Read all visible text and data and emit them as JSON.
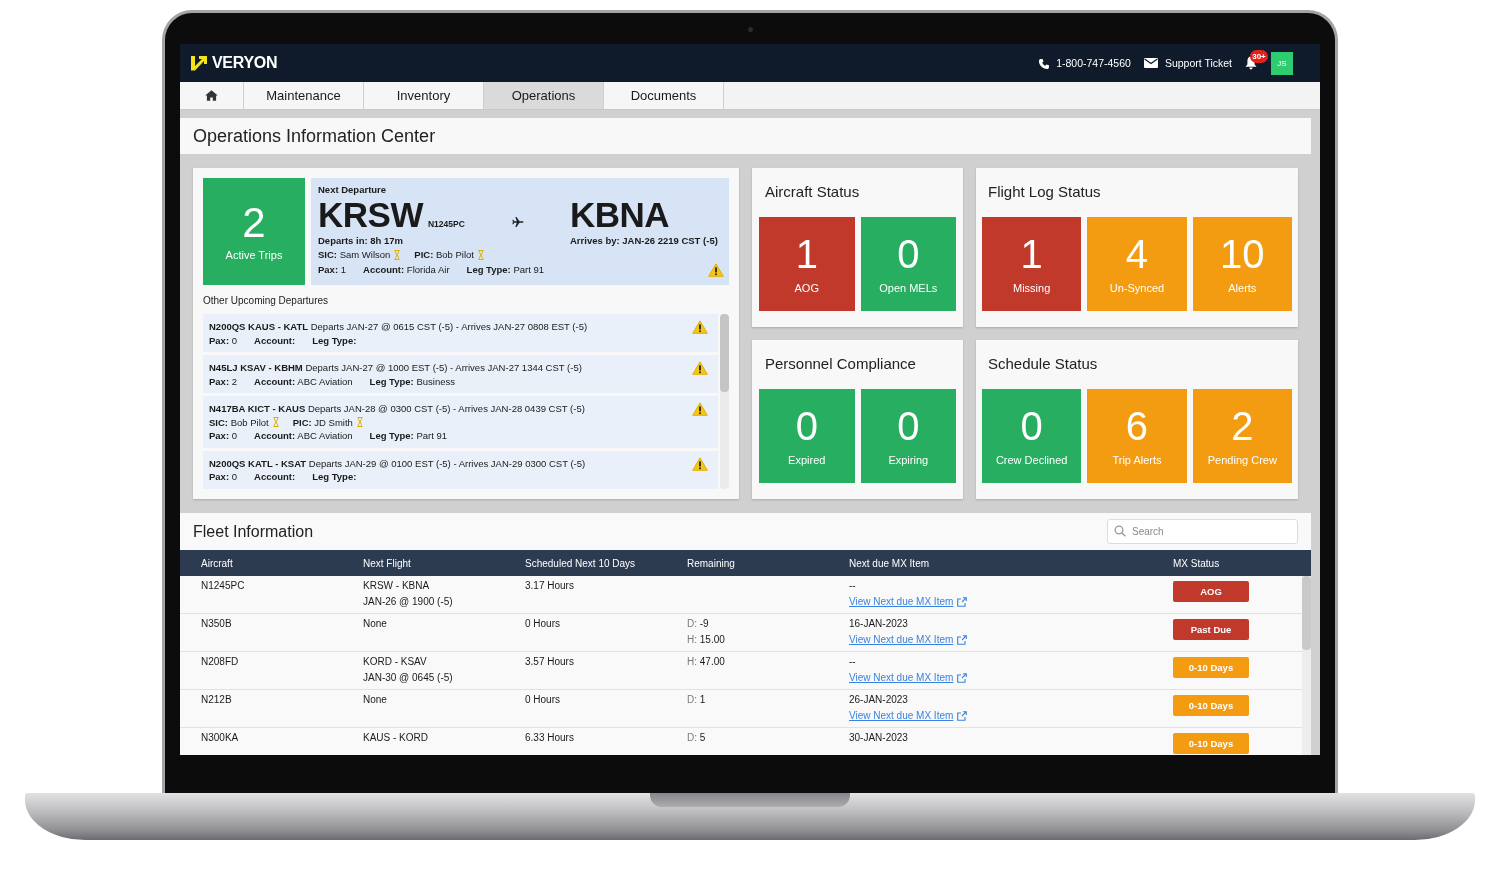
{
  "header": {
    "logo": "VERYON",
    "phone": "1-800-747-4560",
    "support": "Support Ticket",
    "notification_count": "30+",
    "user_initials": "JS"
  },
  "nav": {
    "tabs": [
      {
        "kind": "home",
        "selected": false
      },
      {
        "kind": "text",
        "label": "Maintenance",
        "selected": false
      },
      {
        "kind": "text",
        "label": "Inventory",
        "selected": false
      },
      {
        "kind": "text",
        "label": "Operations",
        "selected": true
      },
      {
        "kind": "text",
        "label": "Documents",
        "selected": false
      }
    ]
  },
  "page_title": "Operations Information Center",
  "trips": {
    "active_trips": {
      "count": "2",
      "label": "Active Trips"
    },
    "next_departure": {
      "heading": "Next Departure",
      "origin": "KRSW",
      "tail_number": "N1245PC",
      "destination": "KBNA",
      "departs": "Departs in: 8h 17m",
      "arrives": "Arrives by: JAN-26 2219 CST (-5)",
      "crew": [
        {
          "label": "SIC:",
          "value": "Sam Wilson"
        },
        {
          "label": "PIC:",
          "value": "Bob Pilot"
        }
      ],
      "details": [
        {
          "label": "Pax:",
          "value": "1"
        },
        {
          "label": "Account:",
          "value": "Florida Air"
        },
        {
          "label": "Leg Type:",
          "value": "Part 91"
        }
      ]
    },
    "upcoming_heading": "Other Upcoming Departures",
    "upcoming": [
      {
        "summary": "**N200QS KAUS - KATL** Departs JAN-27 @ 0615 CST (-5) - Arrives JAN-27 0808 EST (-5)",
        "details": [
          {
            "label": "Pax:",
            "value": "0"
          },
          {
            "label": "Account:"
          },
          {
            "label": "Leg Type:"
          }
        ]
      },
      {
        "summary": "**N45LJ KSAV - KBHM** Departs JAN-27 @ 1000 EST (-5) - Arrives JAN-27 1344 CST (-5)",
        "details": [
          {
            "label": "Pax:",
            "value": "2"
          },
          {
            "label": "Account:",
            "value": "ABC Aviation"
          },
          {
            "label": "Leg Type:",
            "value": "Business"
          }
        ]
      },
      {
        "summary": "**N417BA KICT - KAUS** Departs JAN-28 @ 0300 CST (-5) - Arrives JAN-28 0439 CST (-5)",
        "crew": [
          {
            "label": "SIC:",
            "value": "Bob Pilot"
          },
          {
            "label": "PIC:",
            "value": "JD Smith"
          }
        ],
        "details": [
          {
            "label": "Pax:",
            "value": "0"
          },
          {
            "label": "Account:",
            "value": "ABC Aviation"
          },
          {
            "label": "Leg Type:",
            "value": "Part 91"
          }
        ]
      },
      {
        "summary": "**N200QS KATL - KSAT** Departs JAN-29 @ 0100 EST (-5) - Arrives JAN-29 0300 CST (-5)",
        "details": [
          {
            "label": "Pax:",
            "value": "0"
          },
          {
            "label": "Account:"
          },
          {
            "label": "Leg Type:"
          }
        ]
      }
    ]
  },
  "status_cards": [
    {
      "title": "Aircraft Status",
      "tiles": [
        {
          "value": "1",
          "label": "AOG",
          "color": "#c0392b"
        },
        {
          "value": "0",
          "label": "Open MELs",
          "color": "#27ae60"
        }
      ]
    },
    {
      "title": "Flight Log Status",
      "tiles": [
        {
          "value": "1",
          "label": "Missing",
          "color": "#c0392b"
        },
        {
          "value": "4",
          "label": "Un-Synced",
          "color": "#f39c12"
        },
        {
          "value": "10",
          "label": "Alerts",
          "color": "#f39c12"
        }
      ]
    },
    {
      "title": "Personnel Compliance",
      "tiles": [
        {
          "value": "0",
          "label": "Expired",
          "color": "#27ae60"
        },
        {
          "value": "0",
          "label": "Expiring",
          "color": "#27ae60"
        }
      ]
    },
    {
      "title": "Schedule Status",
      "tiles": [
        {
          "value": "0",
          "label": "Crew Declined",
          "color": "#27ae60"
        },
        {
          "value": "6",
          "label": "Trip Alerts",
          "color": "#f39c12"
        },
        {
          "value": "2",
          "label": "Pending Crew",
          "color": "#f39c12"
        }
      ]
    }
  ],
  "fleet": {
    "title": "Fleet Information",
    "search": {
      "placeholder": "Search"
    },
    "columns": [
      "Aircraft",
      "Next Flight",
      "Scheduled Next 10 Days",
      "Remaining",
      "Next due MX Item",
      "MX Status"
    ],
    "rows": [
      {
        "aircraft": "N1245PC",
        "next_flight": [
          "KRSW - KBNA",
          "JAN-26 @ 1900 (-5)"
        ],
        "scheduled": "3.17 Hours",
        "next_due": "--",
        "link": "View Next due MX Item",
        "status": {
          "label": "AOG",
          "color": "#c0392b"
        }
      },
      {
        "aircraft": "N350B",
        "next_flight": [
          "None"
        ],
        "scheduled": "0 Hours",
        "remaining": [
          {
            "label": "D:",
            "value": "-9"
          },
          {
            "label": "H:",
            "value": "15.00"
          }
        ],
        "next_due": "16-JAN-2023",
        "link": "View Next due MX Item",
        "status": {
          "label": "Past Due",
          "color": "#c0392b"
        }
      },
      {
        "aircraft": "N208FD",
        "next_flight": [
          "KORD - KSAV",
          "JAN-30 @ 0645 (-5)"
        ],
        "scheduled": "3.57 Hours",
        "remaining": [
          {
            "label": "H:",
            "value": "47.00"
          }
        ],
        "next_due": "--",
        "link": "View Next due MX Item",
        "status": {
          "label": "0-10 Days",
          "color": "#f39c12"
        }
      },
      {
        "aircraft": "N212B",
        "next_flight": [
          "None"
        ],
        "scheduled": "0 Hours",
        "remaining": [
          {
            "label": "D:",
            "value": "1"
          }
        ],
        "next_due": "26-JAN-2023",
        "link": "View Next due MX Item",
        "status": {
          "label": "0-10 Days",
          "color": "#f39c12"
        }
      },
      {
        "aircraft": "N300KA",
        "next_flight": [
          "KAUS - KORD"
        ],
        "scheduled": "6.33 Hours",
        "remaining": [
          {
            "label": "D:",
            "value": "5"
          }
        ],
        "next_due": "30-JAN-2023",
        "status": {
          "label": "0-10 Days",
          "color": "#f39c12"
        }
      }
    ]
  }
}
